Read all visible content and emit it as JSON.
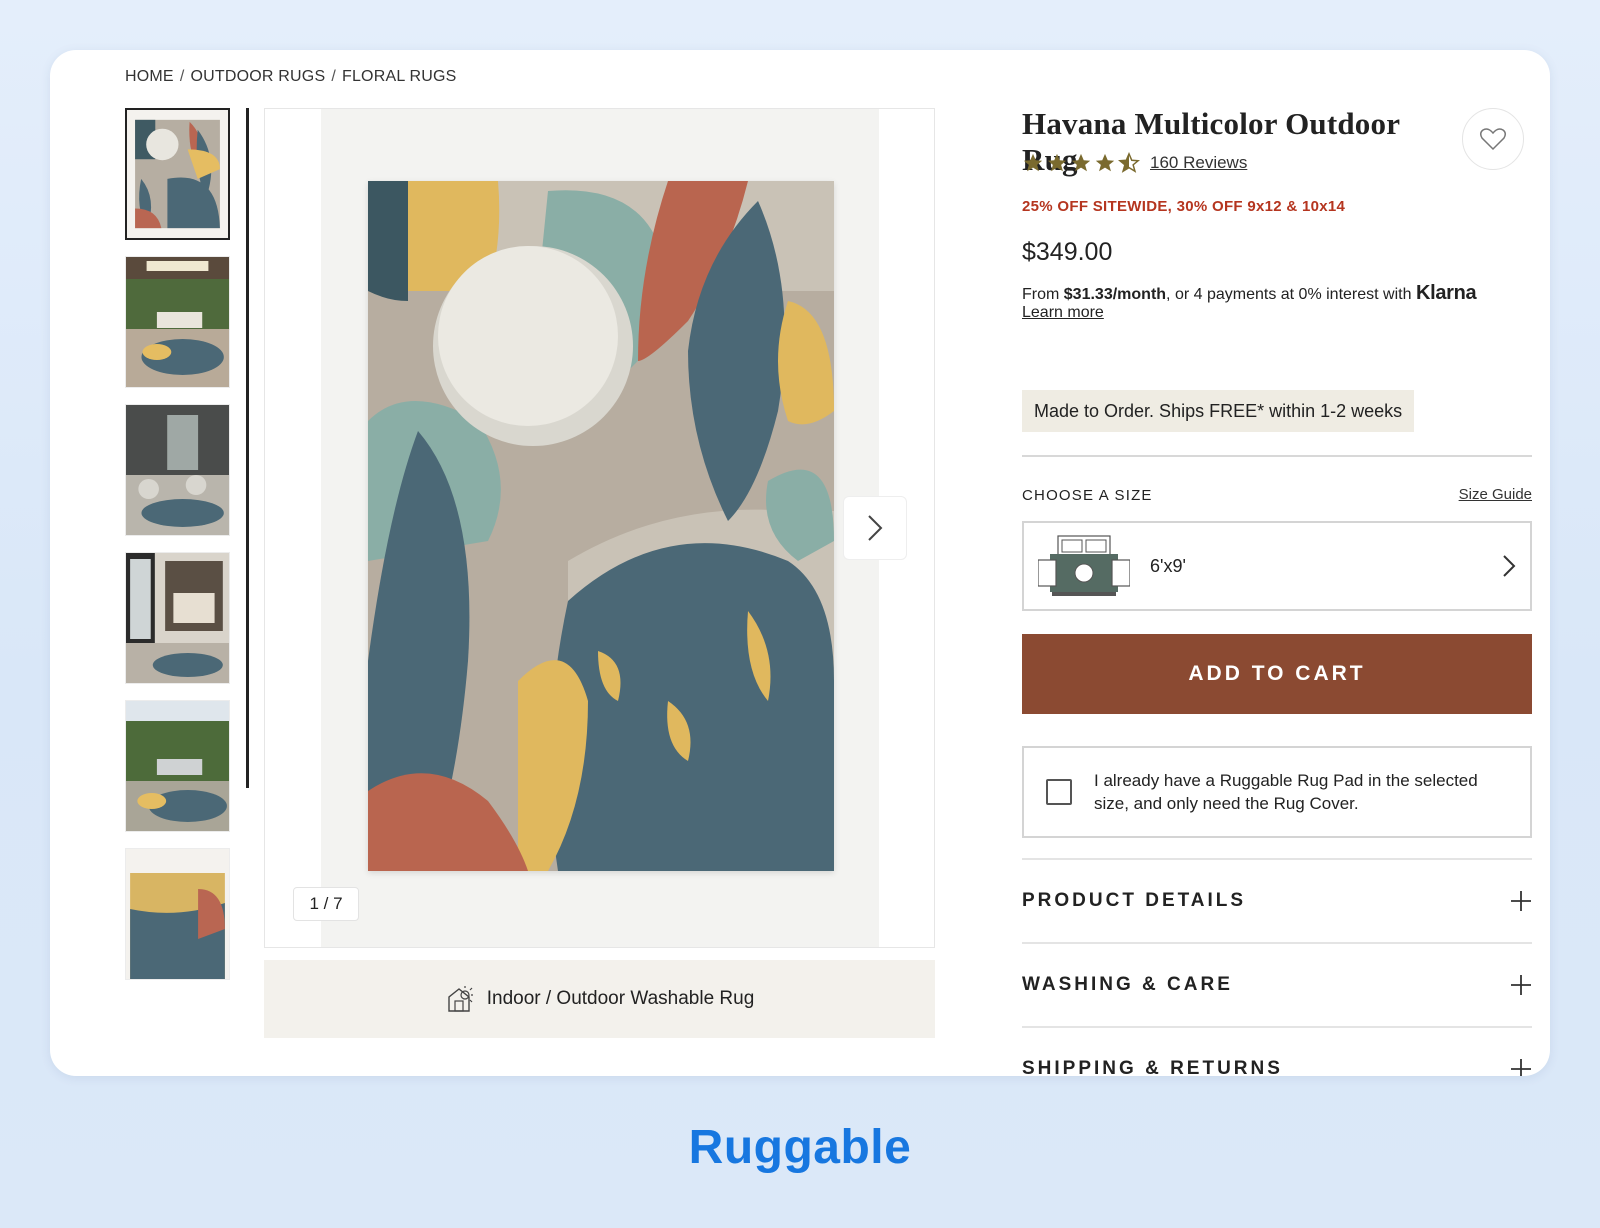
{
  "breadcrumb": {
    "items": [
      "HOME",
      "OUTDOOR RUGS",
      "FLORAL RUGS"
    ],
    "separator": "/"
  },
  "gallery": {
    "counter": "1 / 7",
    "feature_label": "Indoor / Outdoor Washable Rug"
  },
  "product": {
    "title": "Havana Multicolor Outdoor Rug",
    "rating": 4.5,
    "reviews": "160 Reviews",
    "promo": "25% OFF SITEWIDE, 30% OFF 9x12 & 10x14",
    "price": "$349.00",
    "financing": {
      "prefix": "From ",
      "amount": "$31.33/month",
      "middle": ", or 4 payments at 0% interest with ",
      "provider": "Klarna",
      "learn_more": "Learn more"
    },
    "shipping_note": "Made to Order. Ships FREE* within 1-2 weeks"
  },
  "size": {
    "label": "CHOOSE A SIZE",
    "guide_link": "Size Guide",
    "selected": "6'x9'"
  },
  "cart": {
    "add_label": "ADD TO CART"
  },
  "rug_pad": {
    "text": "I already have a Ruggable Rug Pad in the selected size, and only need the Rug Cover."
  },
  "accordions": [
    {
      "label": "PRODUCT DETAILS"
    },
    {
      "label": "WASHING & CARE"
    },
    {
      "label": "SHIPPING & RETURNS"
    }
  ],
  "brand": {
    "name": "Ruggable",
    "color": "#1777e0"
  },
  "colors": {
    "accent": "#8b4a32",
    "promo": "#b5351f",
    "star": "#7a6a2e"
  }
}
